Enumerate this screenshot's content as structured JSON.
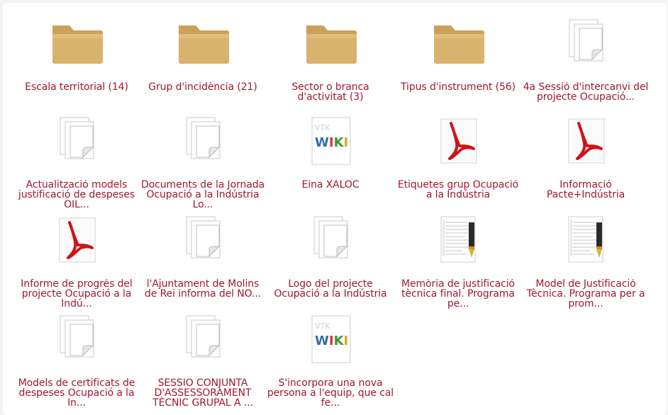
{
  "items": [
    {
      "label": "Escala territorial (14)",
      "icon": "folder-icon"
    },
    {
      "label": "Grup d'incidència (21)",
      "icon": "folder-icon"
    },
    {
      "label": "Sector o branca d'activitat (3)",
      "icon": "folder-icon"
    },
    {
      "label": "Tipus d'instrument (56)",
      "icon": "folder-icon"
    },
    {
      "label": "4a Sessió d'intercanvi del projecte Ocupació...",
      "icon": "document-stack-icon"
    },
    {
      "label": "Actualització models justificació de despeses OIL...",
      "icon": "document-stack-icon"
    },
    {
      "label": "Documents de la Jornada Ocupació a la Indústria Lo...",
      "icon": "document-stack-icon"
    },
    {
      "label": "Eina XALOC",
      "icon": "wiki-icon"
    },
    {
      "label": "Etiquetes grup Ocupació a la Indústria",
      "icon": "pdf-icon"
    },
    {
      "label": "Informació Pacte+Indústria",
      "icon": "pdf-icon"
    },
    {
      "label": "Informe de progrés del projecte Ocupació a la Indú...",
      "icon": "pdf-icon"
    },
    {
      "label": "l'Ajuntament de Molins de Rei informa del NO...",
      "icon": "document-stack-icon"
    },
    {
      "label": "Logo del projecte Ocupació a la Indústria",
      "icon": "document-stack-icon"
    },
    {
      "label": "Memòria de justificació tècnica final. Programa pe...",
      "icon": "text-document-pen-icon"
    },
    {
      "label": "Model de Justificació Tècnica. Programa per a prom...",
      "icon": "text-document-pen-icon"
    },
    {
      "label": "Models de certificats de despeses Ocupació a la In...",
      "icon": "document-stack-icon"
    },
    {
      "label": "SESSIÓ CONJUNTA D'ASSESSORAMENT TÈCNIC GRUPAL A ...",
      "icon": "document-stack-icon"
    },
    {
      "label": "S'incorpora una nova persona a l'equip, que cal fe...",
      "icon": "wiki-icon"
    }
  ],
  "colors": {
    "label": "#a0182e",
    "folder": "#d9b26e",
    "pdf": "#d0131b"
  }
}
